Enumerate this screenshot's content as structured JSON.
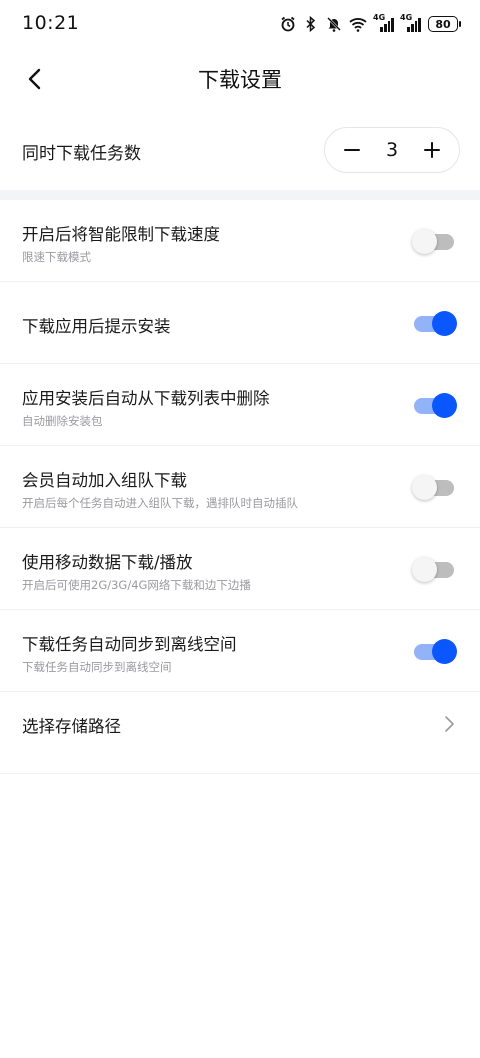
{
  "status_bar": {
    "time": "10:21",
    "signal_label_1": "4G",
    "signal_label_2": "4G",
    "battery": "80",
    "icons": [
      "alarm-icon",
      "bluetooth-icon",
      "mute-icon",
      "wifi-icon",
      "signal-icon",
      "signal-icon",
      "battery-icon"
    ]
  },
  "header": {
    "title": "下载设置",
    "back_icon": "chevron-left-icon"
  },
  "concurrent": {
    "label": "同时下载任务数",
    "value": "3"
  },
  "settings": [
    {
      "title": "开启后将智能限制下载速度",
      "subtitle": "限速下载模式",
      "enabled": false
    },
    {
      "title": "下载应用后提示安装",
      "subtitle": "",
      "enabled": true
    },
    {
      "title": "应用安装后自动从下载列表中删除",
      "subtitle": "自动删除安装包",
      "enabled": true
    },
    {
      "title": "会员自动加入组队下载",
      "subtitle": "开启后每个任务自动进入组队下载，遇排队时自动插队",
      "enabled": false
    },
    {
      "title": "使用移动数据下载/播放",
      "subtitle": "开启后可使用2G/3G/4G网络下载和边下边播",
      "enabled": false
    },
    {
      "title": "下载任务自动同步到离线空间",
      "subtitle": "下载任务自动同步到离线空间",
      "enabled": true
    }
  ],
  "storage": {
    "label": "选择存储路径",
    "icon": "chevron-right-icon"
  },
  "colors": {
    "accent": "#0b57ff",
    "toggle_on_track": "#92b3f7",
    "toggle_off_track": "#bdbdbd",
    "divider": "#f2f4f7",
    "subtitle": "#9a9aa0"
  }
}
